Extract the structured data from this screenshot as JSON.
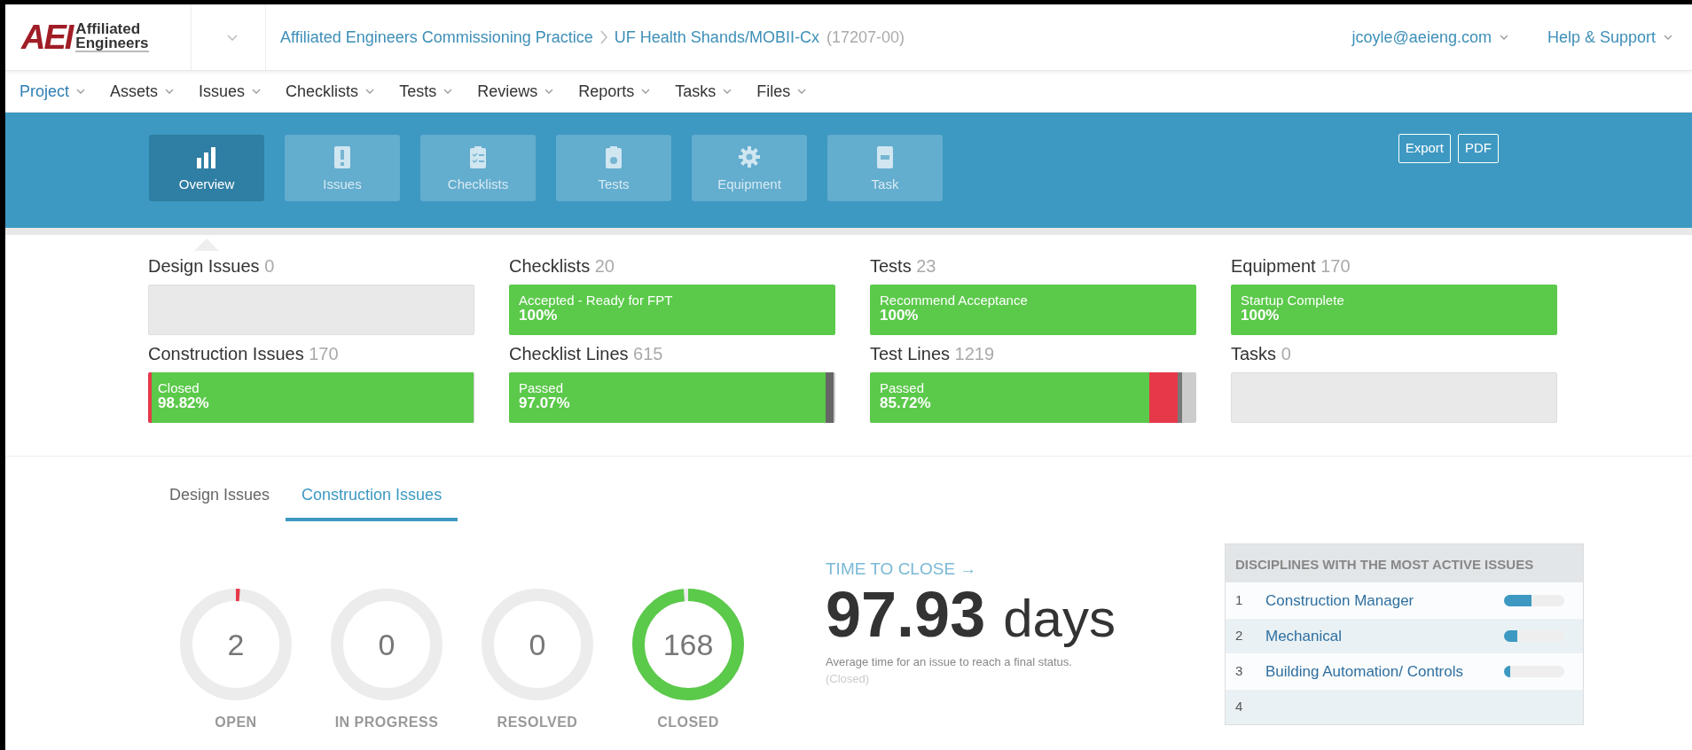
{
  "header": {
    "logo": {
      "mark": "AEI",
      "line1": "Affiliated",
      "line2": "Engineers"
    },
    "breadcrumb": [
      "Affiliated Engineers Commissioning Practice",
      "UF Health Shands/MOBII-Cx"
    ],
    "project_number": "(17207-00)",
    "user": "jcoyle@aeieng.com",
    "help": "Help & Support"
  },
  "menu": [
    {
      "label": "Project",
      "selected": true
    },
    {
      "label": "Assets",
      "selected": false
    },
    {
      "label": "Issues",
      "selected": false
    },
    {
      "label": "Checklists",
      "selected": false
    },
    {
      "label": "Tests",
      "selected": false
    },
    {
      "label": "Reviews",
      "selected": false
    },
    {
      "label": "Reports",
      "selected": false
    },
    {
      "label": "Tasks",
      "selected": false
    },
    {
      "label": "Files",
      "selected": false
    }
  ],
  "dashboard_tabs": [
    {
      "label": "Overview",
      "kind": "chart",
      "selected": true
    },
    {
      "label": "Issues",
      "kind": "issue",
      "selected": false
    },
    {
      "label": "Checklists",
      "kind": "checklist",
      "selected": false
    },
    {
      "label": "Tests",
      "kind": "test",
      "selected": false
    },
    {
      "label": "Equipment",
      "kind": "gear",
      "selected": false
    },
    {
      "label": "Task",
      "kind": "task",
      "selected": false
    }
  ],
  "actions": [
    "Export",
    "PDF"
  ],
  "summary": [
    {
      "title": "Design Issues",
      "count": "0"
    },
    {
      "title": "Checklists",
      "count": "20",
      "status": "Accepted - Ready for FPT",
      "value": "100%",
      "segments": [
        {
          "level": 1,
          "color": "#5bc94a"
        }
      ]
    },
    {
      "title": "Tests",
      "count": "23",
      "status": "Recommend Acceptance",
      "value": "100%",
      "segments": [
        {
          "level": 1,
          "color": "#5bc94a"
        }
      ]
    },
    {
      "title": "Equipment",
      "count": "170",
      "status": "Startup Complete",
      "value": "100%",
      "segments": [
        {
          "level": 1,
          "color": "#5bc94a"
        }
      ]
    },
    {
      "title": "Construction Issues",
      "count": "170",
      "status": "Closed",
      "value": "98.82%",
      "segments": [
        {
          "color": "#e5394a"
        },
        {
          "level": 0.988,
          "color": "#5bc94a"
        }
      ]
    },
    {
      "title": "Checklist Lines",
      "count": "615",
      "status": "Passed",
      "value": "97.07%",
      "segments": [
        {
          "level": 0.9707,
          "color": "#5bc94a"
        },
        {
          "color": "#666666"
        }
      ]
    },
    {
      "title": "Test Lines",
      "count": "1219",
      "status": "Passed",
      "value": "85.72%",
      "segments": [
        {
          "level": 0.8572,
          "color": "#5bc94a"
        },
        {
          "color": "#e5394a"
        },
        {
          "color": "#777777"
        }
      ]
    },
    {
      "title": "Tasks",
      "count": "0"
    }
  ],
  "issue_tabs": [
    {
      "label": "Design Issues",
      "selected": false
    },
    {
      "label": "Construction Issues",
      "selected": true
    }
  ],
  "status_rings": [
    {
      "value": "2",
      "label": "OPEN",
      "level": 0.012,
      "color": "#e5394a"
    },
    {
      "value": "0",
      "label": "IN PROGRESS"
    },
    {
      "value": "0",
      "label": "RESOLVED"
    },
    {
      "value": "168",
      "label": "CLOSED",
      "level": 0.985,
      "color": "#5bc94a"
    }
  ],
  "time_to_close": {
    "heading": "TIME TO CLOSE →",
    "value": "97.93",
    "unit": "days",
    "note": "Average time for an issue to reach a final status.",
    "note_detail": "(Closed)"
  },
  "disciplines": {
    "title": "DISCIPLINES WITH THE MOST ACTIVE ISSUES",
    "rows": [
      {
        "rank": "1",
        "name": "Construction Manager",
        "level": 0.45
      },
      {
        "rank": "2",
        "name": "Mechanical",
        "level": 0.22
      },
      {
        "rank": "3",
        "name": "Building Automation/ Controls",
        "level": 0.1
      },
      {
        "rank": "4"
      }
    ]
  }
}
